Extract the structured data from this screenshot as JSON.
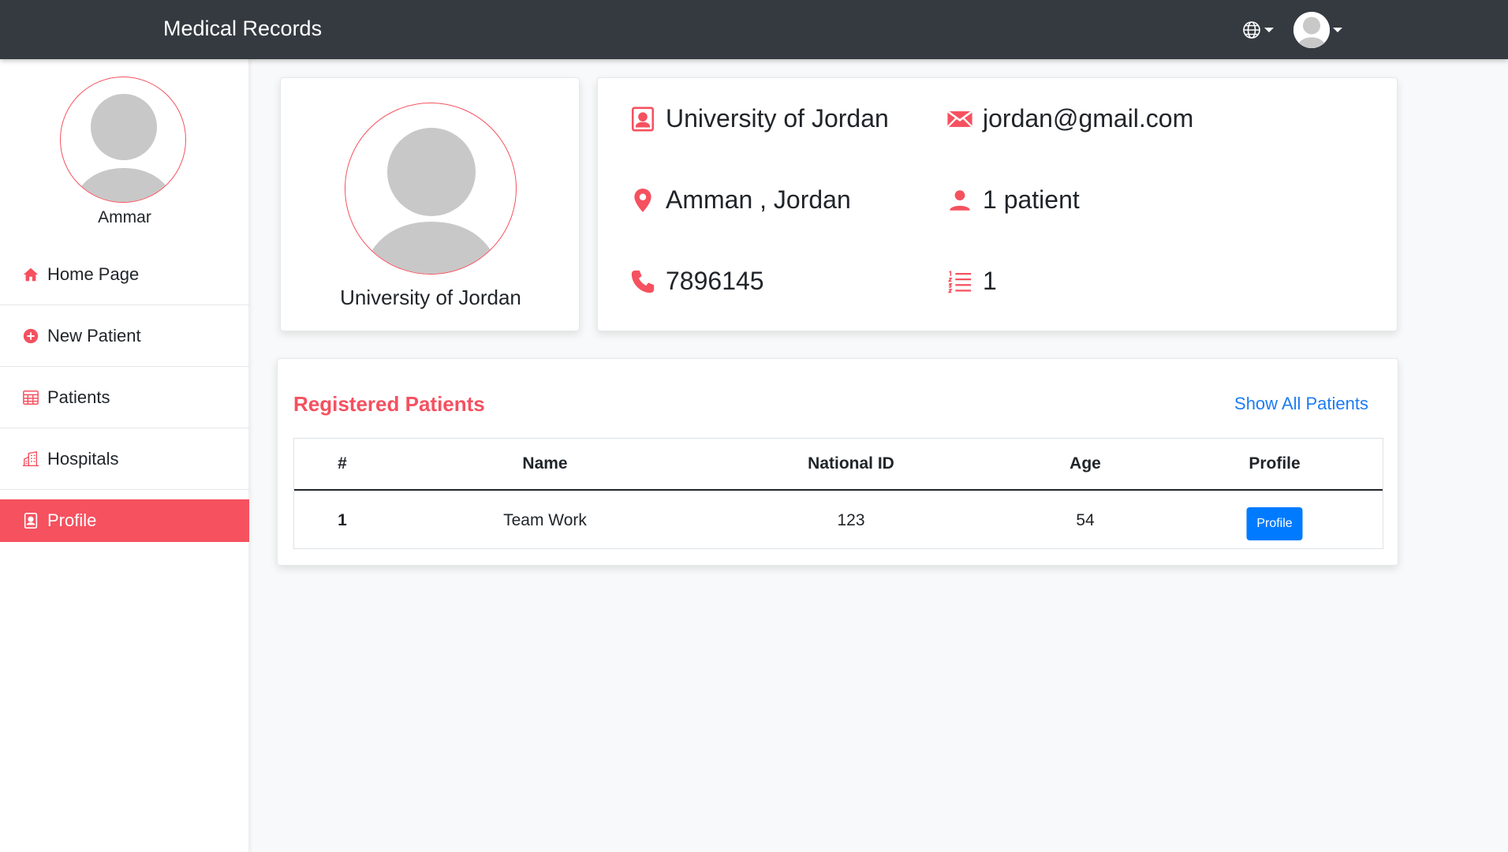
{
  "navbar": {
    "brand": "Medical Records",
    "language_icon": "globe-icon",
    "user_icon": "default-avatar"
  },
  "sidebar": {
    "user_name": "Ammar",
    "items": [
      {
        "label": "Home Page",
        "icon": "home-icon"
      },
      {
        "label": "New Patient",
        "icon": "plus-circle-icon"
      },
      {
        "label": "Patients",
        "icon": "table-icon"
      },
      {
        "label": "Hospitals",
        "icon": "building-icon"
      },
      {
        "label": "Profile",
        "icon": "profile-icon",
        "active": true
      }
    ]
  },
  "profile": {
    "name": "University of Jordan",
    "info": {
      "name": "University of Jordan",
      "email": "jordan@gmail.com",
      "location": "Amman , Jordan",
      "patients": "1 patient",
      "phone": "7896145",
      "count": "1"
    }
  },
  "registered": {
    "title": "Registered Patients",
    "show_all": "Show All Patients",
    "columns": [
      "#",
      "Name",
      "National ID",
      "Age",
      "Profile"
    ],
    "rows": [
      {
        "num": "1",
        "name": "Team Work",
        "national_id": "123",
        "age": "54",
        "button": "Profile"
      }
    ]
  },
  "colors": {
    "accent": "#f5515f",
    "navbar": "#343a40",
    "link": "#1d7cf2",
    "button": "#007bff"
  }
}
